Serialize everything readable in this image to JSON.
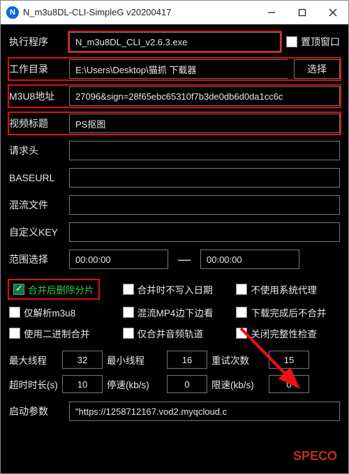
{
  "window": {
    "title": "N_m3u8DL-CLI-SimpleG v20200417"
  },
  "rows": {
    "exec_label": "执行程序",
    "exec_value": "N_m3u8DL_CLI_v2.6.3.exe",
    "pin_label": "置顶窗口",
    "workdir_label": "工作目录",
    "workdir_value": "E:\\Users\\Desktop\\猫抓 下载器",
    "choose_btn": "选择",
    "m3u8_label": "M3U8地址",
    "m3u8_value": "27096&sign=28f65ebc65310f7b3de0db6d0da1cc6c",
    "title_label": "视频标题",
    "title_value": "PS抠图",
    "header_label": "请求头",
    "header_value": "",
    "baseurl_label": "BASEURL",
    "baseurl_value": "",
    "mux_label": "混流文件",
    "mux_value": "",
    "key_label": "自定义KEY",
    "key_value": "",
    "range_label": "范围选择",
    "range_start": "00:00:00",
    "range_end": "00:00:00"
  },
  "checks": {
    "c1": "合并后删除分片",
    "c2": "合并时不写入日期",
    "c3": "不使用系统代理",
    "c4": "仅解析m3u8",
    "c5": "混流MP4边下边看",
    "c6": "下载完成后不合并",
    "c7": "使用二进制合并",
    "c8": "仅合并音频轨道",
    "c9": "关闭完整性检查"
  },
  "nums": {
    "max_threads_label": "最大线程",
    "max_threads": "32",
    "min_threads_label": "最小线程",
    "min_threads": "16",
    "retry_label": "重试次数",
    "retry": "15",
    "timeout_label": "超时时长(s)",
    "timeout": "10",
    "stop_label": "停速(kb/s)",
    "stop": "0",
    "limit_label": "限速(kb/s)",
    "limit": "0"
  },
  "launch": {
    "label": "启动参数",
    "value": "\"https://1258712167.vod2.myqcloud.c"
  },
  "watermark": "SPECO"
}
